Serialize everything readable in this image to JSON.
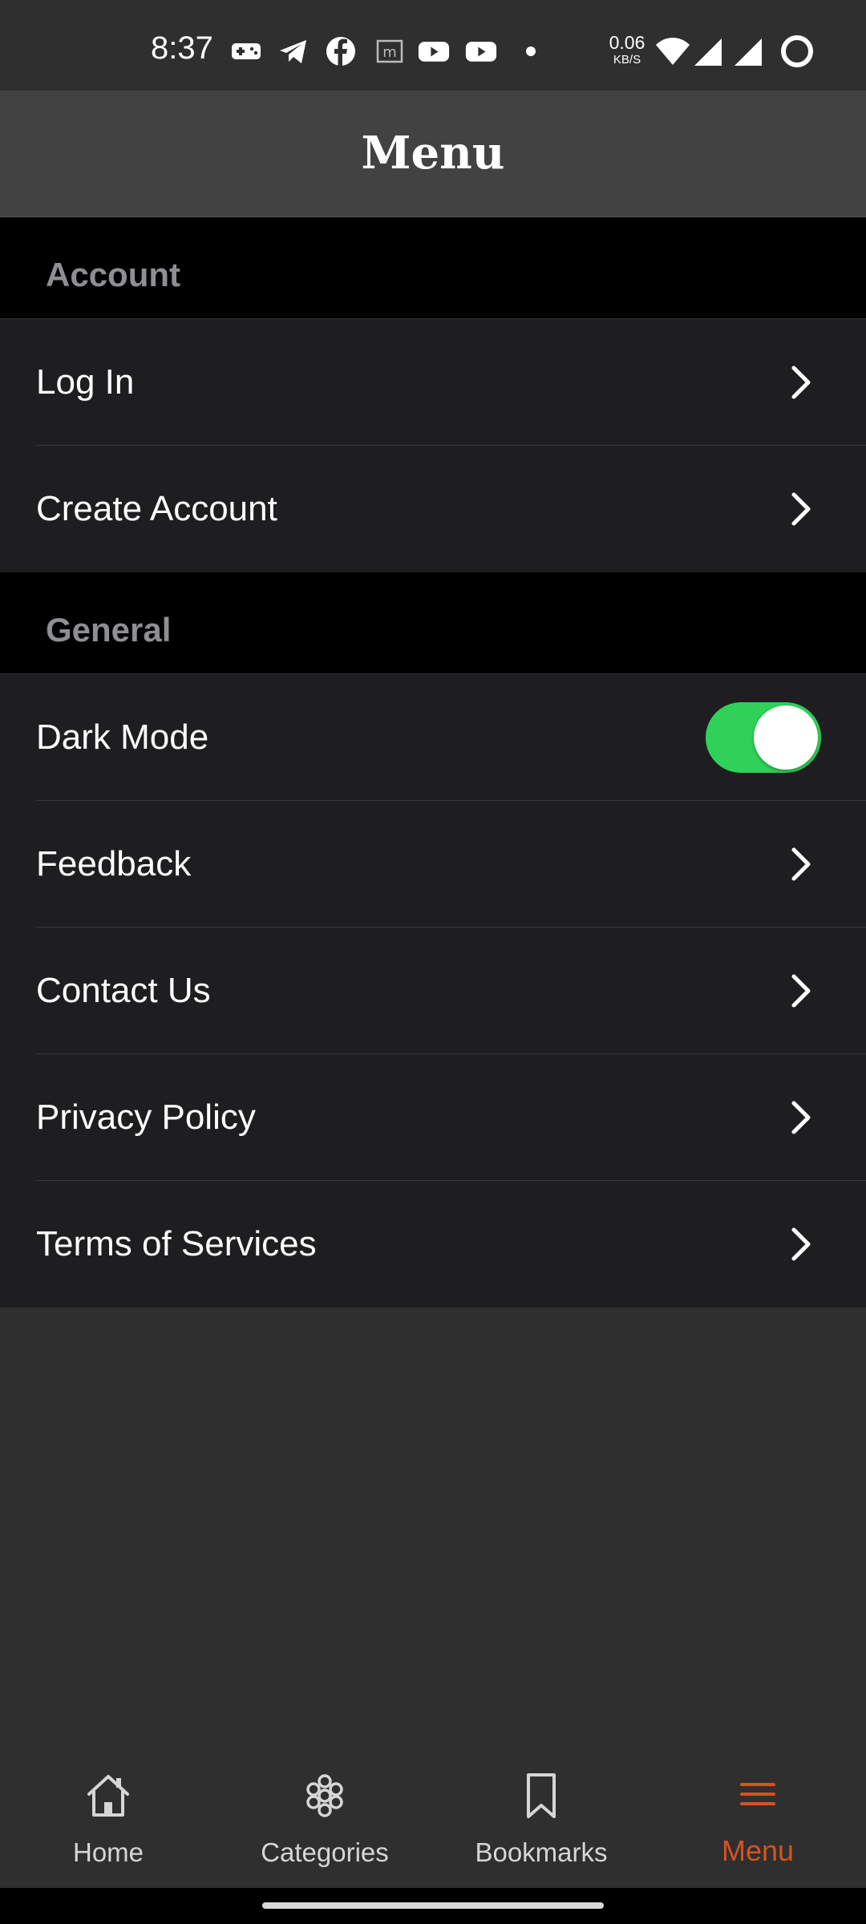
{
  "status_bar": {
    "time": "8:37",
    "net_speed_value": "0.06",
    "net_speed_unit": "KB/S",
    "icons": [
      "gamepad-icon",
      "telegram-icon",
      "facebook-icon",
      "app-m-icon",
      "youtube-icon",
      "youtube-icon",
      "dot-icon",
      "wifi-icon",
      "signal-icon",
      "signal-icon",
      "battery-ring-icon"
    ]
  },
  "header": {
    "title": "Menu"
  },
  "sections": {
    "account": {
      "title": "Account",
      "items": [
        {
          "label": "Log In"
        },
        {
          "label": "Create Account"
        }
      ]
    },
    "general": {
      "title": "General",
      "dark_mode_label": "Dark Mode",
      "dark_mode_on": true,
      "items": [
        {
          "label": "Feedback"
        },
        {
          "label": "Contact Us"
        },
        {
          "label": "Privacy Policy"
        },
        {
          "label": "Terms of Services"
        }
      ]
    }
  },
  "bottom_nav": {
    "items": [
      {
        "label": "Home",
        "icon": "home-icon"
      },
      {
        "label": "Categories",
        "icon": "categories-icon"
      },
      {
        "label": "Bookmarks",
        "icon": "bookmark-icon"
      },
      {
        "label": "Menu",
        "icon": "menu-icon"
      }
    ],
    "active": "Menu"
  },
  "colors": {
    "accent": "#d4541f",
    "toggle_on": "#30d158",
    "background": "#2f2f2f",
    "row_background": "#1e1e20",
    "section_header_background": "#000000",
    "section_header_text": "#8e8e93"
  }
}
